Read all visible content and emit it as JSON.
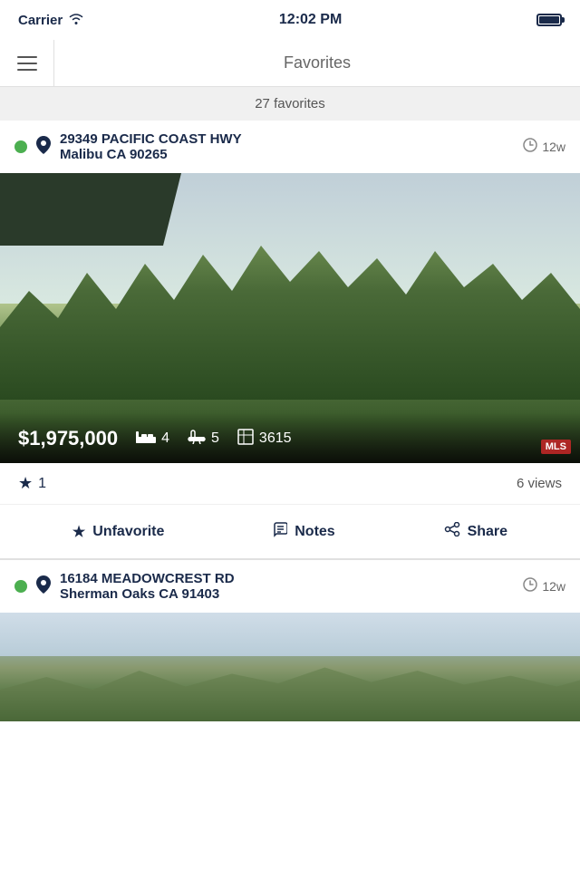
{
  "statusBar": {
    "carrier": "Carrier",
    "time": "12:02 PM",
    "wifi": true,
    "battery": "full"
  },
  "nav": {
    "title": "Favorites",
    "hamburger_label": "Menu"
  },
  "favoritesBar": {
    "count_text": "27 favorites"
  },
  "listings": [
    {
      "id": "listing-1",
      "status": "active",
      "street": "29349 PACIFIC COAST HWY",
      "city_state_zip": "Malibu CA 90265",
      "time_ago": "12w",
      "price": "$1,975,000",
      "beds": "4",
      "baths": "5",
      "sqft": "3615",
      "star_count": "1",
      "views": "6 views",
      "actions": {
        "unfavorite": "Unfavorite",
        "notes": "Notes",
        "share": "Share"
      }
    },
    {
      "id": "listing-2",
      "status": "active",
      "street": "16184 MEADOWCREST RD",
      "city_state_zip": "Sherman Oaks CA 91403",
      "time_ago": "12w"
    }
  ]
}
